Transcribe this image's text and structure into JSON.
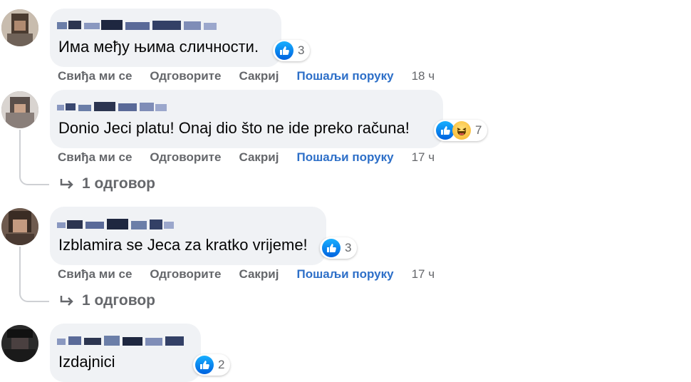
{
  "actions": {
    "like": "Свиђа ми се",
    "reply": "Одговорите",
    "hide": "Сакриј",
    "send_message": "Пошаљи поруку"
  },
  "comments": [
    {
      "text": "Има међу њима сличности.",
      "reactions": [
        "like-icon"
      ],
      "reaction_count": "3",
      "time": "18 ч"
    },
    {
      "text": "Donio Jeci platu! Onaj dio što ne ide preko računa!",
      "reactions": [
        "like-icon",
        "haha-icon"
      ],
      "reaction_count": "7",
      "time": "17 ч",
      "replies_label": "1 одговор"
    },
    {
      "text": "Izblamira se Jeca za kratko vrijeme!",
      "reactions": [
        "like-icon"
      ],
      "reaction_count": "3",
      "time": "17 ч",
      "replies_label": "1 одговор"
    },
    {
      "text": "Izdajnici",
      "reactions": [
        "like-icon"
      ],
      "reaction_count": "2"
    }
  ],
  "colors": {
    "bubble": "#f0f2f5",
    "action_text": "#65676b",
    "send_link": "#2d6fc8",
    "like_blue": "#0866ff"
  }
}
